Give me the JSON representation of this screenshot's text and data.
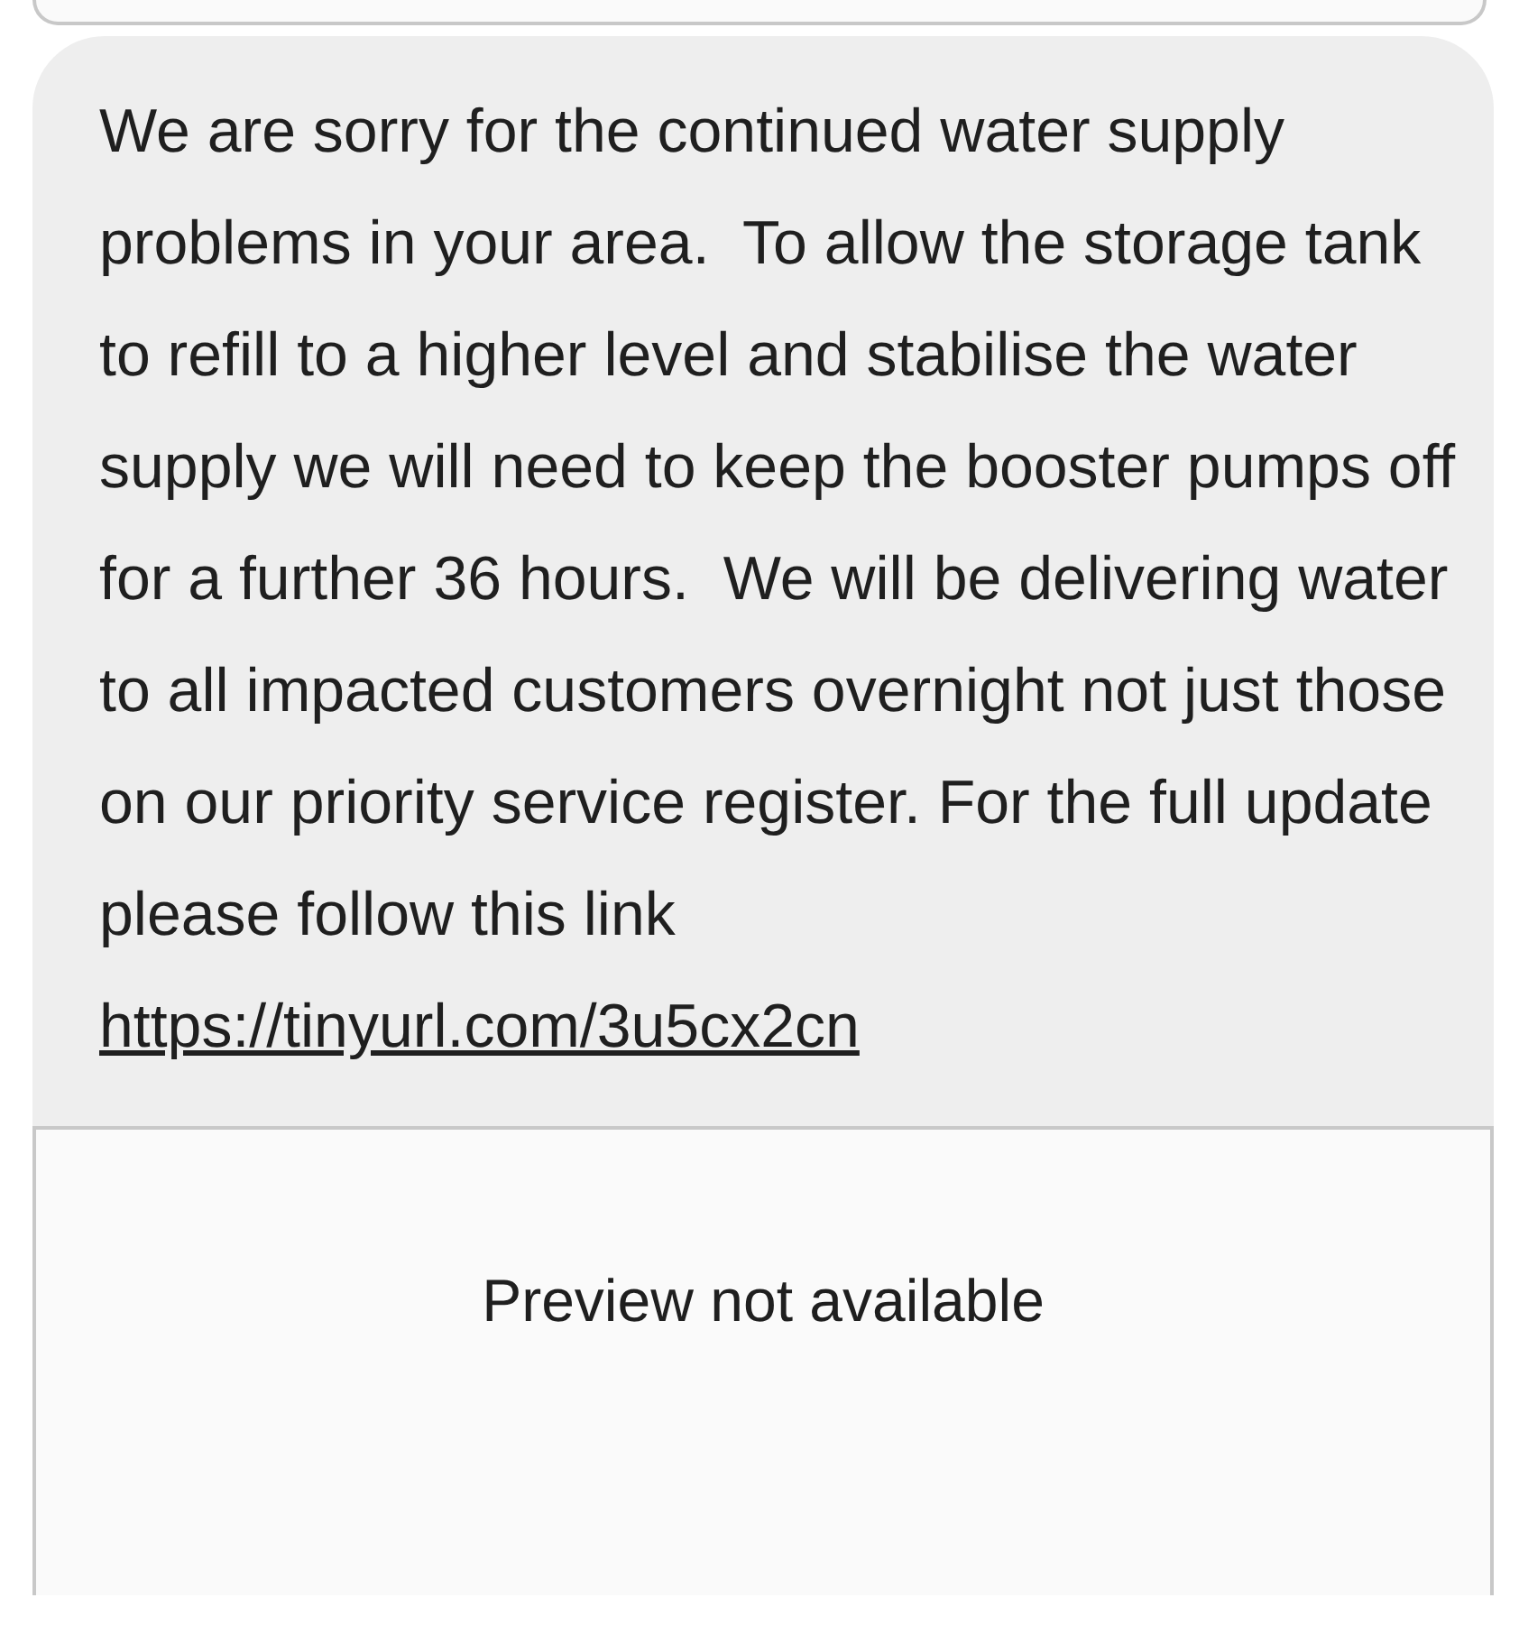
{
  "message": {
    "text": "We are sorry for the continued water supply problems in your area.  To allow the storage tank to refill to a higher level and stabilise the water supply we will need to keep the booster pumps off for a further 36 hours.  We will be delivering water to all impacted customers overnight not just those on our priority service register. For the full update please follow this link",
    "link": "https://tinyurl.com/3u5cx2cn"
  },
  "preview": {
    "text": "Preview not available"
  }
}
